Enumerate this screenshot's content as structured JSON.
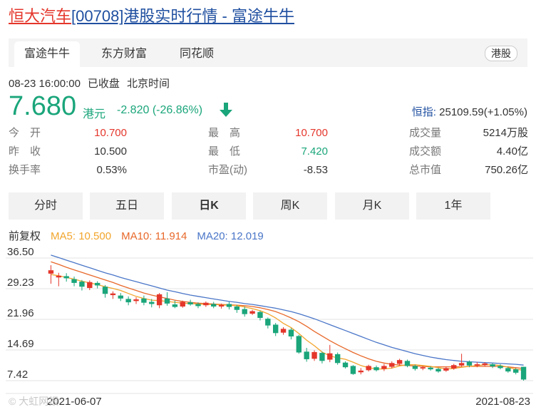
{
  "page": {
    "title_stock": "恒大汽车",
    "title_rest": "[00708]港股实时行情 - 富途牛牛",
    "sources": [
      "富途牛牛",
      "东方财富",
      "同花顺"
    ],
    "market_tag": "港股",
    "datetime": "08-23 16:00:00",
    "status": "已收盘",
    "timezone": "北京时间",
    "price": "7.680",
    "currency": "港元",
    "change": "-2.820 (-26.86%)",
    "hsi_label": "恒指:",
    "hsi_value": "25109.59(+1.05%)",
    "stats": [
      {
        "k": "今　开",
        "v": "10.700",
        "c": "red"
      },
      {
        "k": "最　高",
        "v": "10.700",
        "c": "red"
      },
      {
        "k": "成交量",
        "v": "5214万股",
        "c": "dark"
      },
      {
        "k": "昨　收",
        "v": "10.500",
        "c": "dark"
      },
      {
        "k": "最　低",
        "v": "7.420",
        "c": "green"
      },
      {
        "k": "成交额",
        "v": "4.40亿",
        "c": "dark"
      },
      {
        "k": "换手率",
        "v": "0.53%",
        "c": "dark"
      },
      {
        "k": "市盈(动)",
        "v": "-8.53",
        "c": "dark"
      },
      {
        "k": "总市值",
        "v": "750.26亿",
        "c": "dark"
      }
    ],
    "k_tabs": [
      "分时",
      "五日",
      "日K",
      "周K",
      "月K",
      "1年"
    ],
    "adjust": "前复权",
    "ma5": "MA5: 10.500",
    "ma10": "MA10: 11.914",
    "ma20": "MA20: 12.019",
    "watermark": "大虹网报",
    "colors": {
      "up": "#e4362b",
      "down": "#1aa57a",
      "ma5": "#f2a52c",
      "ma10": "#e8682a",
      "ma20": "#4a76c8"
    }
  },
  "chart_data": {
    "type": "candlestick",
    "y_ticks": [
      "36.50",
      "29.23",
      "21.96",
      "14.69",
      "7.42"
    ],
    "ylim": [
      7.42,
      36.5
    ],
    "x_labels": [
      "2021-06-07",
      "2021-08-23"
    ],
    "candles": [
      [
        32.8,
        33.6,
        30.4,
        34.8
      ],
      [
        31.9,
        32.3,
        29.8,
        33.0
      ],
      [
        32.2,
        31.7,
        30.9,
        32.9
      ],
      [
        31.5,
        30.6,
        29.8,
        32.1
      ],
      [
        30.9,
        29.7,
        28.8,
        31.3
      ],
      [
        29.4,
        30.8,
        28.9,
        31.2
      ],
      [
        30.6,
        30.0,
        29.3,
        31.0
      ],
      [
        29.7,
        28.0,
        27.1,
        30.1
      ],
      [
        27.7,
        28.1,
        26.8,
        28.6
      ],
      [
        27.6,
        26.9,
        26.3,
        28.2
      ],
      [
        26.8,
        26.0,
        25.3,
        27.4
      ],
      [
        26.3,
        26.7,
        25.6,
        27.2
      ],
      [
        26.9,
        25.9,
        25.3,
        27.6
      ],
      [
        26.1,
        25.6,
        24.8,
        26.8
      ],
      [
        25.3,
        27.9,
        24.6,
        28.2
      ],
      [
        26.9,
        25.7,
        25.2,
        28.4
      ],
      [
        25.5,
        24.9,
        24.6,
        26.4
      ],
      [
        25.0,
        26.1,
        24.7,
        26.4
      ],
      [
        26.0,
        25.5,
        25.2,
        26.6
      ],
      [
        25.6,
        25.1,
        24.6,
        26.0
      ],
      [
        25.3,
        25.9,
        24.9,
        26.2
      ],
      [
        25.6,
        25.0,
        24.6,
        26.1
      ],
      [
        25.0,
        25.4,
        24.5,
        25.7
      ],
      [
        25.6,
        24.9,
        24.3,
        26.1
      ],
      [
        25.0,
        24.2,
        23.5,
        25.4
      ],
      [
        24.4,
        23.2,
        22.6,
        25.0
      ],
      [
        23.3,
        23.9,
        23.0,
        24.2
      ],
      [
        23.7,
        22.3,
        21.7,
        24.0
      ],
      [
        22.1,
        20.5,
        19.8,
        22.4
      ],
      [
        20.7,
        18.7,
        18.0,
        21.1
      ],
      [
        18.8,
        19.7,
        18.3,
        20.1
      ],
      [
        19.5,
        17.9,
        17.2,
        19.9
      ],
      [
        18.0,
        14.1,
        13.8,
        18.3
      ],
      [
        14.3,
        12.5,
        11.9,
        15.2
      ],
      [
        12.6,
        14.2,
        12.1,
        14.6
      ],
      [
        14.0,
        12.1,
        11.5,
        14.3
      ],
      [
        12.4,
        13.9,
        11.8,
        15.9
      ],
      [
        13.7,
        11.6,
        11.2,
        14.1
      ],
      [
        11.7,
        10.6,
        10.3,
        12.0
      ],
      [
        10.9,
        9.0,
        8.8,
        11.1
      ],
      [
        9.4,
        9.8,
        8.9,
        10.4
      ],
      [
        9.9,
        10.9,
        9.6,
        11.2
      ],
      [
        10.6,
        9.9,
        9.6,
        11.0
      ],
      [
        10.2,
        10.9,
        9.7,
        11.4
      ],
      [
        10.7,
        11.6,
        10.3,
        12.0
      ],
      [
        11.4,
        12.3,
        11.0,
        12.6
      ],
      [
        12.1,
        10.9,
        10.6,
        12.4
      ],
      [
        10.9,
        10.2,
        9.8,
        11.2
      ],
      [
        10.3,
        10.6,
        9.9,
        10.9
      ],
      [
        10.5,
        10.1,
        9.8,
        10.8
      ],
      [
        10.2,
        9.6,
        9.3,
        10.5
      ],
      [
        9.8,
        10.4,
        9.5,
        10.7
      ],
      [
        10.3,
        11.1,
        10.0,
        11.4
      ],
      [
        11.0,
        11.6,
        10.7,
        13.8
      ],
      [
        11.9,
        11.0,
        10.6,
        12.2
      ],
      [
        11.0,
        11.3,
        10.6,
        11.8
      ],
      [
        11.1,
        11.5,
        10.8,
        11.8
      ],
      [
        11.3,
        10.8,
        10.4,
        11.6
      ],
      [
        10.9,
        10.4,
        10.1,
        11.3
      ],
      [
        10.4,
        9.6,
        9.3,
        10.7
      ],
      [
        10.1,
        9.3,
        8.9,
        10.4
      ],
      [
        10.7,
        7.68,
        7.42,
        10.7
      ]
    ],
    "ma5_series": [
      32.6,
      32.3,
      31.9,
      31.5,
      31.0,
      30.6,
      30.2,
      29.7,
      29.3,
      28.8,
      28.1,
      27.4,
      26.9,
      26.5,
      26.4,
      26.2,
      26.0,
      25.8,
      25.7,
      25.6,
      25.5,
      25.5,
      25.4,
      25.3,
      25.2,
      24.9,
      24.5,
      24.0,
      23.3,
      22.3,
      21.0,
      20.0,
      18.6,
      17.0,
      15.7,
      14.2,
      13.3,
      12.8,
      12.5,
      11.8,
      11.0,
      10.5,
      10.2,
      10.2,
      10.4,
      10.9,
      11.2,
      11.2,
      11.0,
      10.8,
      10.5,
      10.2,
      10.3,
      10.6,
      10.8,
      11.0,
      11.2,
      11.2,
      11.0,
      10.6,
      10.1,
      9.9
    ],
    "ma10_series": [
      35.6,
      35.0,
      34.3,
      33.7,
      33.1,
      32.5,
      31.9,
      31.3,
      30.7,
      30.0,
      29.4,
      28.8,
      28.2,
      27.7,
      27.3,
      26.9,
      26.5,
      26.2,
      26.0,
      25.8,
      25.7,
      25.6,
      25.5,
      25.4,
      25.3,
      25.2,
      25.0,
      24.7,
      24.3,
      23.8,
      23.1,
      22.3,
      21.4,
      20.3,
      19.1,
      18.0,
      16.9,
      15.9,
      15.0,
      14.1,
      13.3,
      12.6,
      12.0,
      11.6,
      11.3,
      11.1,
      11.0,
      10.9,
      10.8,
      10.7,
      10.7,
      10.7,
      10.7,
      10.7,
      10.8,
      10.8,
      10.8,
      10.8,
      10.8,
      10.7,
      10.5,
      10.3
    ],
    "ma20_series": [
      37.2,
      36.6,
      36.0,
      35.4,
      34.8,
      34.2,
      33.6,
      33.0,
      32.5,
      31.9,
      31.4,
      30.9,
      30.4,
      29.9,
      29.4,
      28.9,
      28.5,
      28.1,
      27.7,
      27.4,
      27.1,
      26.8,
      26.5,
      26.2,
      26.0,
      25.7,
      25.5,
      25.2,
      24.9,
      24.6,
      24.2,
      23.8,
      23.3,
      22.7,
      22.1,
      21.4,
      20.7,
      20.0,
      19.3,
      18.6,
      17.9,
      17.2,
      16.5,
      15.9,
      15.3,
      14.8,
      14.3,
      13.8,
      13.4,
      13.0,
      12.7,
      12.4,
      12.2,
      12.0,
      11.9,
      11.8,
      11.7,
      11.6,
      11.5,
      11.4,
      11.3,
      11.1
    ]
  }
}
